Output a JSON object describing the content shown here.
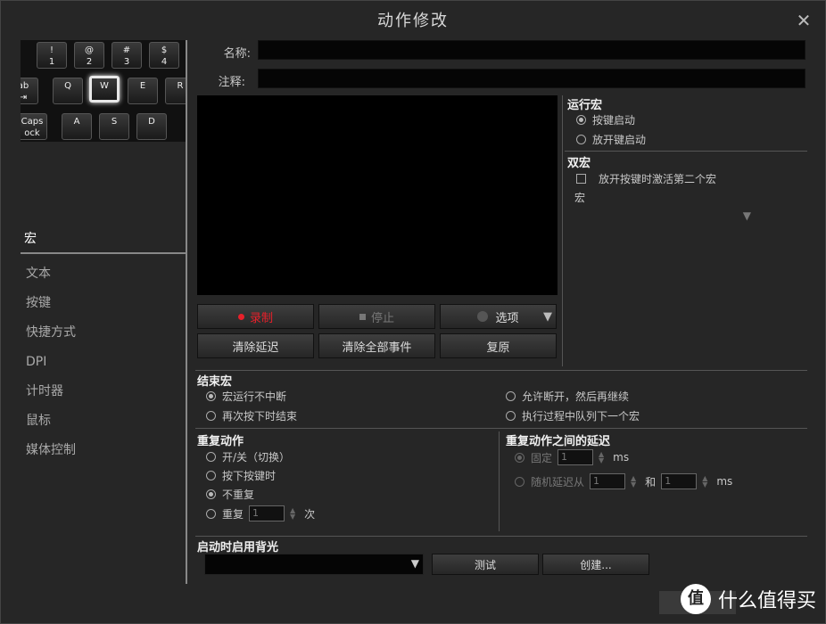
{
  "window": {
    "title": "动作修改"
  },
  "keyboard": {
    "keys": [
      {
        "label": "!\n1"
      },
      {
        "label": "@\n2"
      },
      {
        "label": "#\n3"
      },
      {
        "label": "$\n4"
      },
      {
        "label": "ab\n⇥"
      },
      {
        "label": "Q"
      },
      {
        "label": "W"
      },
      {
        "label": "E"
      },
      {
        "label": "R"
      },
      {
        "label": "Caps\nock"
      },
      {
        "label": "A"
      },
      {
        "label": "S"
      },
      {
        "label": "D"
      }
    ]
  },
  "sidebar": {
    "items": [
      {
        "label": "宏"
      },
      {
        "label": "文本"
      },
      {
        "label": "按键"
      },
      {
        "label": "快捷方式"
      },
      {
        "label": "DPI"
      },
      {
        "label": "计时器"
      },
      {
        "label": "鼠标"
      },
      {
        "label": "媒体控制"
      }
    ]
  },
  "form": {
    "name_label": "名称:",
    "note_label": "注释:",
    "name_value": "",
    "note_value": ""
  },
  "buttons": {
    "record": "录制",
    "stop": "停止",
    "options": "选项",
    "clear_delay": "清除延迟",
    "clear_all": "清除全部事件",
    "restore": "复原",
    "test": "测试",
    "create": "创建..."
  },
  "run_macro": {
    "title": "运行宏",
    "on_press": "按键启动",
    "on_release": "放开键启动"
  },
  "double_macro": {
    "title": "双宏",
    "activate_second": "放开按键时激活第二个宏",
    "macro_label": "宏"
  },
  "end_macro": {
    "title": "结束宏",
    "opt1": "宏运行不中断",
    "opt2": "再次按下时结束",
    "opt3": "允许断开，然后再继续",
    "opt4": "执行过程中队列下一个宏"
  },
  "repeat": {
    "title": "重复动作",
    "toggle": "开/关（切换）",
    "while_pressed": "按下按键时",
    "no_repeat": "不重复",
    "repeat": "重复",
    "repeat_count": "1",
    "times": "次"
  },
  "delay": {
    "title": "重复动作之间的延迟",
    "fixed": "固定",
    "fixed_value": "1",
    "ms": "ms",
    "random": "随机延迟从",
    "random_from": "1",
    "and": "和",
    "random_to": "1",
    "ms2": "ms"
  },
  "backlight": {
    "title": "启动时启用背光"
  },
  "watermark": {
    "badge": "值",
    "text": "什么值得买"
  }
}
